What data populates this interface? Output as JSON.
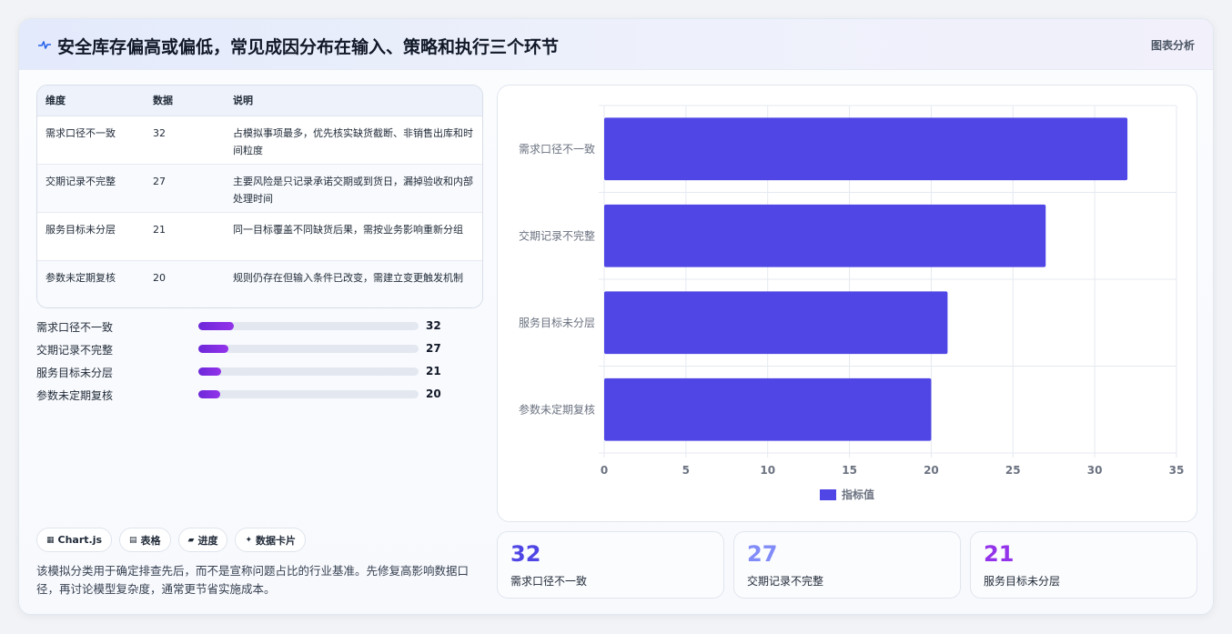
{
  "header": {
    "icon": "pulse-icon",
    "title": "安全库存偏高或偏低，常见成因分布在输入、策略和执行三个环节",
    "tag": "图表分析"
  },
  "table": {
    "columns": [
      "维度",
      "数据",
      "说明"
    ],
    "rows": [
      [
        "需求口径不一致",
        "32",
        "占模拟事项最多，优先核实缺货截断、非销售出库和时间粒度"
      ],
      [
        "交期记录不完整",
        "27",
        "主要风险是只记录承诺交期或到货日，漏掉验收和内部处理时间"
      ],
      [
        "服务目标未分层",
        "21",
        "同一目标覆盖不同缺货后果，需按业务影响重新分组"
      ],
      [
        "参数未定期复核",
        "20",
        "规则仍存在但输入条件已改变，需建立变更触发机制"
      ]
    ]
  },
  "progress": [
    {
      "label": "需求口径不一致",
      "value": "32",
      "fraction": 0.16
    },
    {
      "label": "交期记录不完整",
      "value": "27",
      "fraction": 0.135
    },
    {
      "label": "服务目标未分层",
      "value": "21",
      "fraction": 0.105
    },
    {
      "label": "参数未定期复核",
      "value": "20",
      "fraction": 0.1
    }
  ],
  "chips": [
    {
      "icon": "chart-icon",
      "glyph": "▦",
      "label": "Chart.js"
    },
    {
      "icon": "table-icon",
      "glyph": "▤",
      "label": "表格"
    },
    {
      "icon": "progress-icon",
      "glyph": "▰",
      "label": "进度"
    },
    {
      "icon": "sparkle-icon",
      "glyph": "✦",
      "label": "数据卡片"
    }
  ],
  "footnote": "该模拟分类用于确定排查先后，而不是宣称问题占比的行业基准。先修复高影响数据口径，再讨论模型复杂度，通常更节省实施成本。",
  "stats": [
    {
      "value": "32",
      "label": "需求口径不一致",
      "color": "#4f46e5"
    },
    {
      "value": "27",
      "label": "交期记录不完整",
      "color": "#818cf8"
    },
    {
      "value": "21",
      "label": "服务目标未分层",
      "color": "#9333ea"
    }
  ],
  "colors": {
    "bar": "#4f46e5",
    "grid": "#e5e9f0",
    "axis_text": "#6b7280"
  },
  "chart_data": {
    "type": "bar",
    "orientation": "horizontal",
    "categories": [
      "需求口径不一致",
      "交期记录不完整",
      "服务目标未分层",
      "参数未定期复核"
    ],
    "series": [
      {
        "name": "指标值",
        "values": [
          32,
          27,
          21,
          20
        ]
      }
    ],
    "xlim": [
      0,
      35
    ],
    "xticks": [
      "0",
      "5",
      "10",
      "15",
      "20",
      "25",
      "30",
      "35"
    ],
    "grid": true,
    "legend": "bottom"
  }
}
